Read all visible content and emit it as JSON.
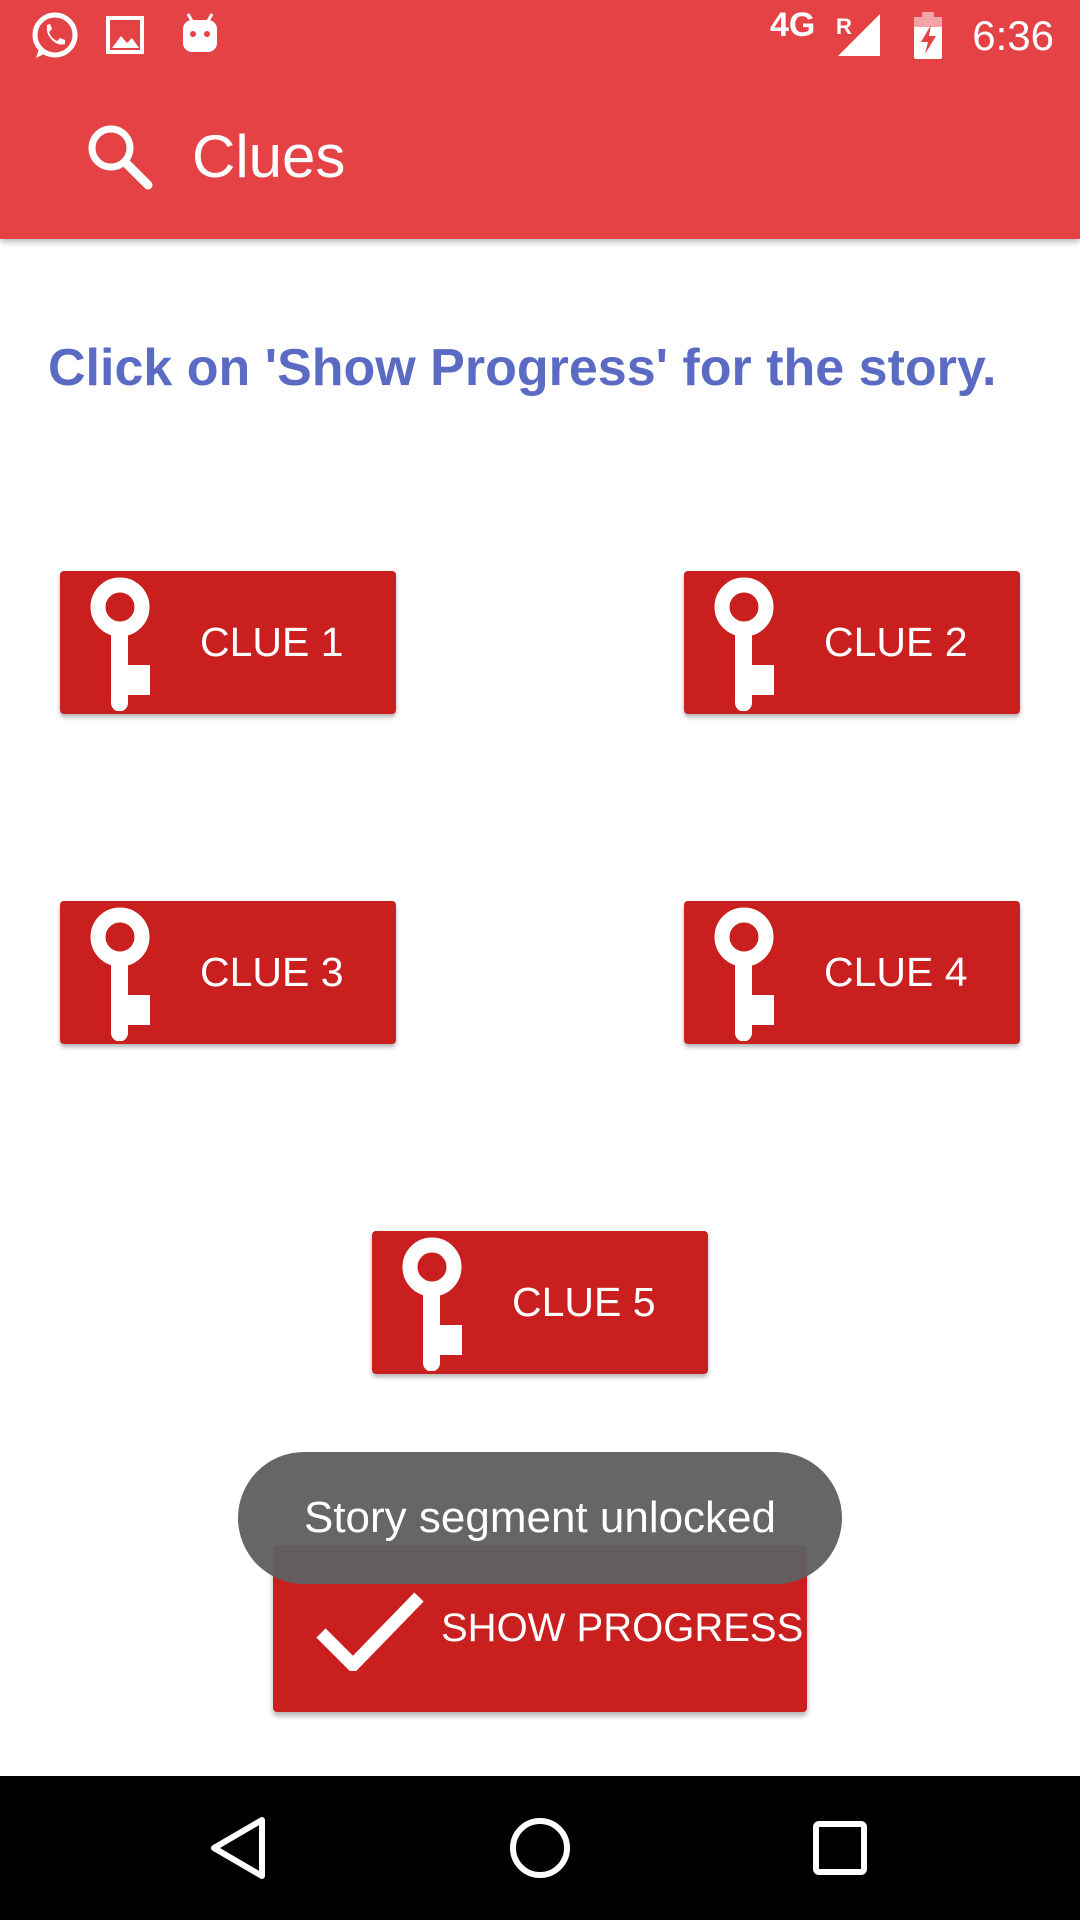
{
  "status_bar": {
    "network": "4G",
    "roaming": "R",
    "time": "6:36",
    "icons": [
      "whatsapp-icon",
      "gallery-icon",
      "android-icon",
      "signal-icon",
      "battery-charging-icon"
    ]
  },
  "app_bar": {
    "title": "Clues",
    "icon": "search-icon",
    "background": "#e44245"
  },
  "main": {
    "instruction": "Click on 'Show Progress' for the story.",
    "clues": [
      {
        "label": "CLUE 1",
        "icon": "key-icon"
      },
      {
        "label": "CLUE 2",
        "icon": "key-icon"
      },
      {
        "label": "CLUE 3",
        "icon": "key-icon"
      },
      {
        "label": "CLUE 4",
        "icon": "key-icon"
      },
      {
        "label": "CLUE 5",
        "icon": "key-icon"
      }
    ],
    "show_progress": {
      "label": "SHOW PROGRESS",
      "icon": "check-icon"
    },
    "button_color": "#c91f1f",
    "instruction_color": "#5b6bc4"
  },
  "toast": {
    "message": "Story segment unlocked"
  },
  "nav_bar": {
    "buttons": [
      "back-icon",
      "home-icon",
      "recents-icon"
    ]
  }
}
